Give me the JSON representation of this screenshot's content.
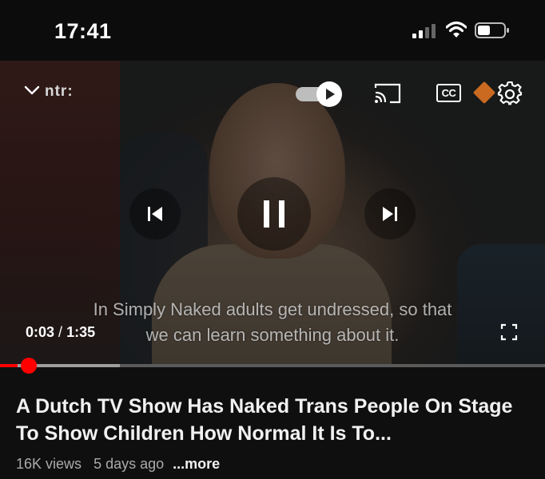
{
  "status_bar": {
    "time": "17:41",
    "signal_icon": "cellular-signal-icon",
    "wifi_icon": "wifi-icon",
    "battery_icon": "battery-icon"
  },
  "player": {
    "channel_logo": "ntr:",
    "caption": "In Simply Naked adults get undressed, so that we can learn something about it.",
    "current_time": "0:03",
    "separator": "/",
    "duration": "1:35",
    "progress_fraction": 0.032,
    "buffered_fraction": 0.22,
    "cc_label": "CC",
    "accent_color": "#ff0000",
    "icons": {
      "minimize": "chevron-down-icon",
      "autoplay": "autoplay-toggle-icon",
      "cast": "cast-icon",
      "captions": "closed-captions-icon",
      "settings": "gear-icon",
      "previous": "skip-previous-icon",
      "pause": "pause-icon",
      "next": "skip-next-icon",
      "fullscreen": "fullscreen-icon"
    }
  },
  "video_info": {
    "title": "A Dutch TV Show Has Naked Trans People On Stage To Show Children How Normal It Is To...",
    "views": "16K views",
    "uploaded": "5 days ago",
    "more_label": "...more"
  }
}
